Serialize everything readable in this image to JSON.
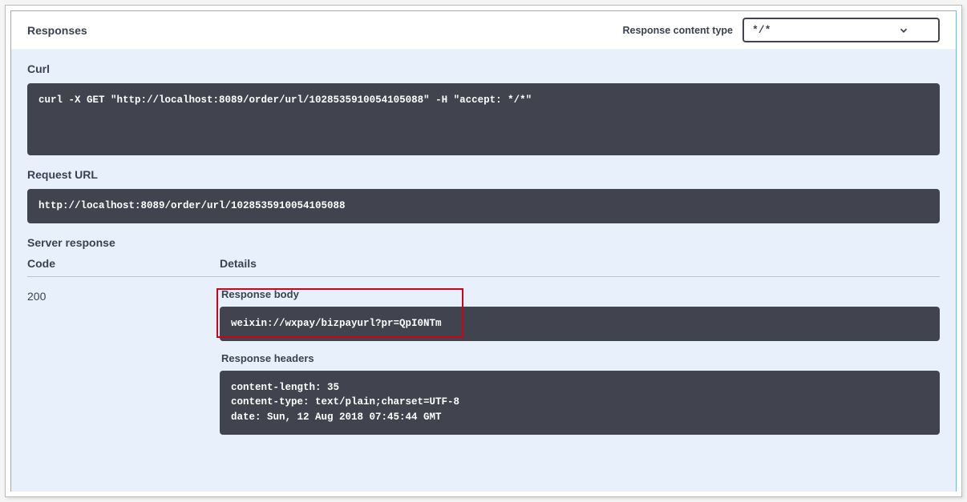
{
  "header": {
    "title": "Responses",
    "content_type_label": "Response content type",
    "content_type_value": "*/*"
  },
  "curl": {
    "label": "Curl",
    "command": "curl -X GET \"http://localhost:8089/order/url/1028535910054105088\" -H \"accept: */*\""
  },
  "request_url": {
    "label": "Request URL",
    "value": "http://localhost:8089/order/url/1028535910054105088"
  },
  "server_response": {
    "label": "Server response",
    "code_header": "Code",
    "details_header": "Details",
    "code_value": "200",
    "response_body_label": "Response body",
    "response_body": "weixin://wxpay/bizpayurl?pr=QpI0NTm",
    "response_headers_label": "Response headers",
    "response_headers": "content-length: 35\ncontent-type: text/plain;charset=UTF-8\ndate: Sun, 12 Aug 2018 07:45:44 GMT"
  }
}
